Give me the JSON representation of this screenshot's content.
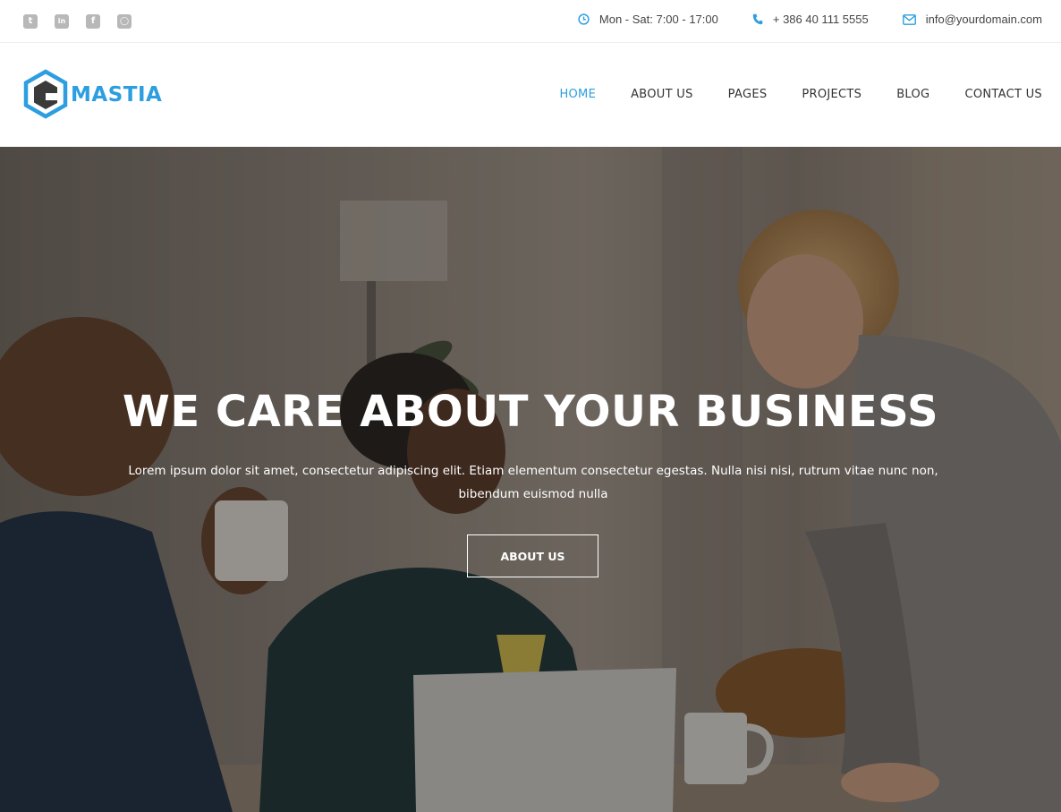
{
  "topbar": {
    "social": [
      {
        "icon": "twitter-icon",
        "glyph": "t"
      },
      {
        "icon": "linkedin-icon",
        "glyph": "in"
      },
      {
        "icon": "facebook-icon",
        "glyph": "f"
      },
      {
        "icon": "github-icon",
        "glyph": "◯"
      }
    ],
    "hours": "Mon - Sat: 7:00 - 17:00",
    "phone": "+ 386 40 111 5555",
    "email": "info@yourdomain.com"
  },
  "header": {
    "logo_text": "MASTIA",
    "nav": [
      "HOME",
      "ABOUT US",
      "PAGES",
      "PROJECTS",
      "BLOG",
      "CONTACT US"
    ],
    "active_nav": "HOME"
  },
  "hero": {
    "title": "WE CARE ABOUT YOUR BUSINESS",
    "text_line1": "Lorem ipsum dolor sit amet, consectetur adipiscing elit. Etiam elementum consectetur egestas. Nulla nisi nisi, rutrum vitae nunc non,",
    "text_line2": "bibendum euismod nulla",
    "button_label": "ABOUT US"
  },
  "colors": {
    "accent": "#2d9ee0",
    "icon_gray": "#b8b8b8",
    "logo_dark": "#3a3a3a"
  }
}
